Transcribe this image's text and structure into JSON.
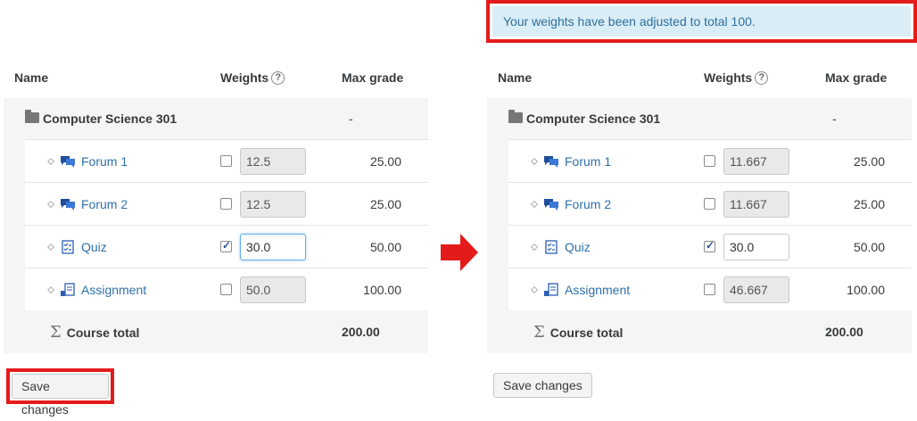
{
  "alert": {
    "text": "Your weights have been adjusted to total 100."
  },
  "headers": {
    "name": "Name",
    "weights": "Weights",
    "max_grade": "Max grade"
  },
  "category": {
    "name": "Computer Science 301",
    "max": "-"
  },
  "total": {
    "label": "Course total",
    "max": "200.00"
  },
  "save_label": "Save changes",
  "before": {
    "items": [
      {
        "name": "Forum 1",
        "type": "forum",
        "checked": false,
        "weight": "12.5",
        "max": "25.00"
      },
      {
        "name": "Forum 2",
        "type": "forum",
        "checked": false,
        "weight": "12.5",
        "max": "25.00"
      },
      {
        "name": "Quiz",
        "type": "quiz",
        "checked": true,
        "weight": "30.0",
        "max": "50.00"
      },
      {
        "name": "Assignment",
        "type": "assignment",
        "checked": false,
        "weight": "50.0",
        "max": "100.00"
      }
    ]
  },
  "after": {
    "items": [
      {
        "name": "Forum 1",
        "type": "forum",
        "checked": false,
        "weight": "11.667",
        "max": "25.00"
      },
      {
        "name": "Forum 2",
        "type": "forum",
        "checked": false,
        "weight": "11.667",
        "max": "25.00"
      },
      {
        "name": "Quiz",
        "type": "quiz",
        "checked": true,
        "weight": "30.0",
        "max": "50.00"
      },
      {
        "name": "Assignment",
        "type": "assignment",
        "checked": false,
        "weight": "46.667",
        "max": "100.00"
      }
    ]
  },
  "colors": {
    "highlight": "#e41b1b",
    "link": "#2f6fab",
    "alert_bg": "#d9edf7"
  }
}
